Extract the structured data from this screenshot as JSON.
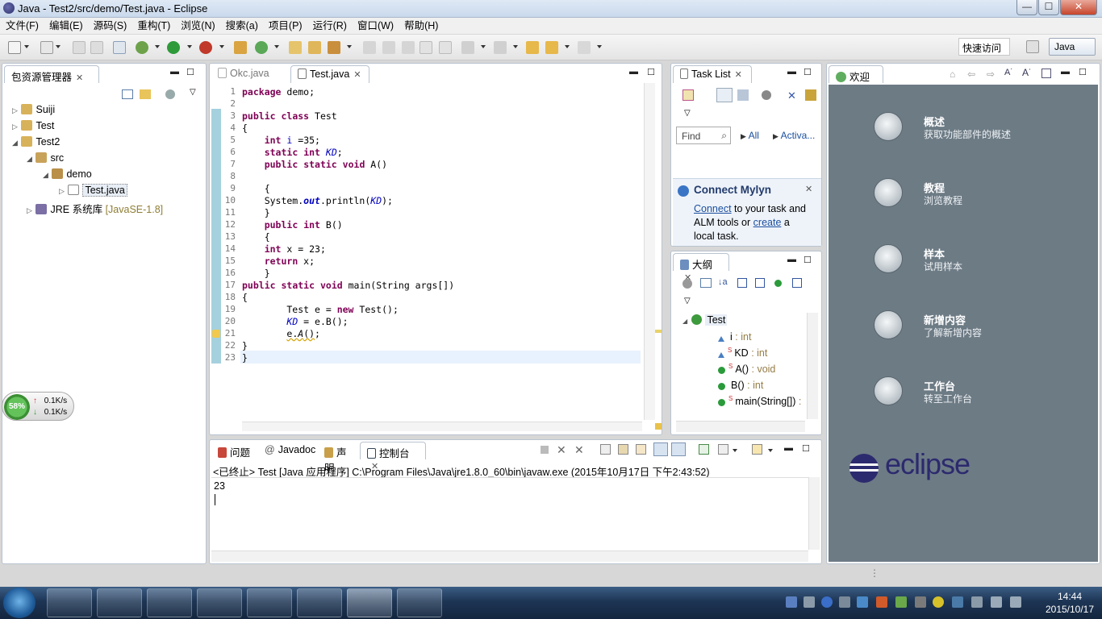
{
  "window": {
    "title": "Java - Test2/src/demo/Test.java - Eclipse",
    "min": "—",
    "max": "☐",
    "close": "✕"
  },
  "menu": [
    "文件(F)",
    "编辑(E)",
    "源码(S)",
    "重构(T)",
    "浏览(N)",
    "搜索(a)",
    "项目(P)",
    "运行(R)",
    "窗口(W)",
    "帮助(H)"
  ],
  "toolbar": {
    "quick_access": "快速访问",
    "perspective": "Java"
  },
  "explorer": {
    "title": "包资源管理器",
    "tree": [
      {
        "label": "Suiji",
        "level": 0,
        "toggle": "▷"
      },
      {
        "label": "Test",
        "level": 0,
        "toggle": "▷"
      },
      {
        "label": "Test2",
        "level": 0,
        "toggle": "◢"
      },
      {
        "label": "src",
        "level": 1,
        "toggle": "◢"
      },
      {
        "label": "demo",
        "level": 2,
        "toggle": "◢"
      },
      {
        "label": "Test.java",
        "level": 3,
        "toggle": "▷"
      },
      {
        "label": "JRE 系统库",
        "level": 1,
        "toggle": "▷",
        "suffix": "[JavaSE-1.8]"
      }
    ]
  },
  "editor": {
    "tabs": [
      "Okc.java",
      "Test.java"
    ],
    "active_tab": "Test.java",
    "line_numbers": [
      "1",
      "2",
      "3",
      "4",
      "5",
      "6",
      "7",
      "8",
      "9",
      "10",
      "11",
      "12",
      "13",
      "14",
      "15",
      "16",
      "17",
      "18",
      "19",
      "20",
      "21",
      "22",
      "23"
    ]
  },
  "tasklist": {
    "title": "Task List",
    "find_placeholder": "Find",
    "all": "All",
    "activate": "Activa...",
    "mylyn_title": "Connect Mylyn",
    "mylyn_connect": "Connect",
    "mylyn_text1": "to your task and",
    "mylyn_text2": "ALM tools or",
    "mylyn_create": "create",
    "mylyn_text3": "a",
    "mylyn_text4": "local task."
  },
  "outline": {
    "title": "大纲",
    "class": "Test",
    "members": [
      {
        "name": "i",
        "type": ": int",
        "static": ""
      },
      {
        "name": "KD",
        "type": ": int",
        "static": "S"
      },
      {
        "name": "A()",
        "type": ": void",
        "static": "S"
      },
      {
        "name": "B()",
        "type": ": int",
        "static": ""
      },
      {
        "name": "main(String[])",
        "type": ":",
        "static": "S"
      }
    ]
  },
  "welcome": {
    "title": "欢迎",
    "items": [
      {
        "title": "概述",
        "subtitle": "获取功能部件的概述",
        "icon": "globe-icon"
      },
      {
        "title": "教程",
        "subtitle": "浏览教程",
        "icon": "tutorial-icon"
      },
      {
        "title": "样本",
        "subtitle": "试用样本",
        "icon": "samples-icon"
      },
      {
        "title": "新增内容",
        "subtitle": "了解新增内容",
        "icon": "star-icon"
      },
      {
        "title": "工作台",
        "subtitle": "转至工作台",
        "icon": "workbench-icon"
      }
    ],
    "logo": "eclipse"
  },
  "bottom": {
    "tabs": [
      "问题",
      "Javadoc",
      "声明",
      "控制台"
    ],
    "active_tab": "控制台",
    "header": "<已终止> Test [Java 应用程序] C:\\Program Files\\Java\\jre1.8.0_60\\bin\\javaw.exe (2015年10月17日 下午2:43:52)",
    "output": "23"
  },
  "net_widget": {
    "percent": "58%",
    "up": "0.1K/s",
    "down": "0.1K/s"
  },
  "taskbar": {
    "time": "14:44",
    "date": "2015/10/17"
  },
  "colors": {
    "keyword": "#7f0055",
    "field": "#0000c0",
    "welcome_bg": "#6d7b85",
    "taskbar": "#1d3554"
  }
}
